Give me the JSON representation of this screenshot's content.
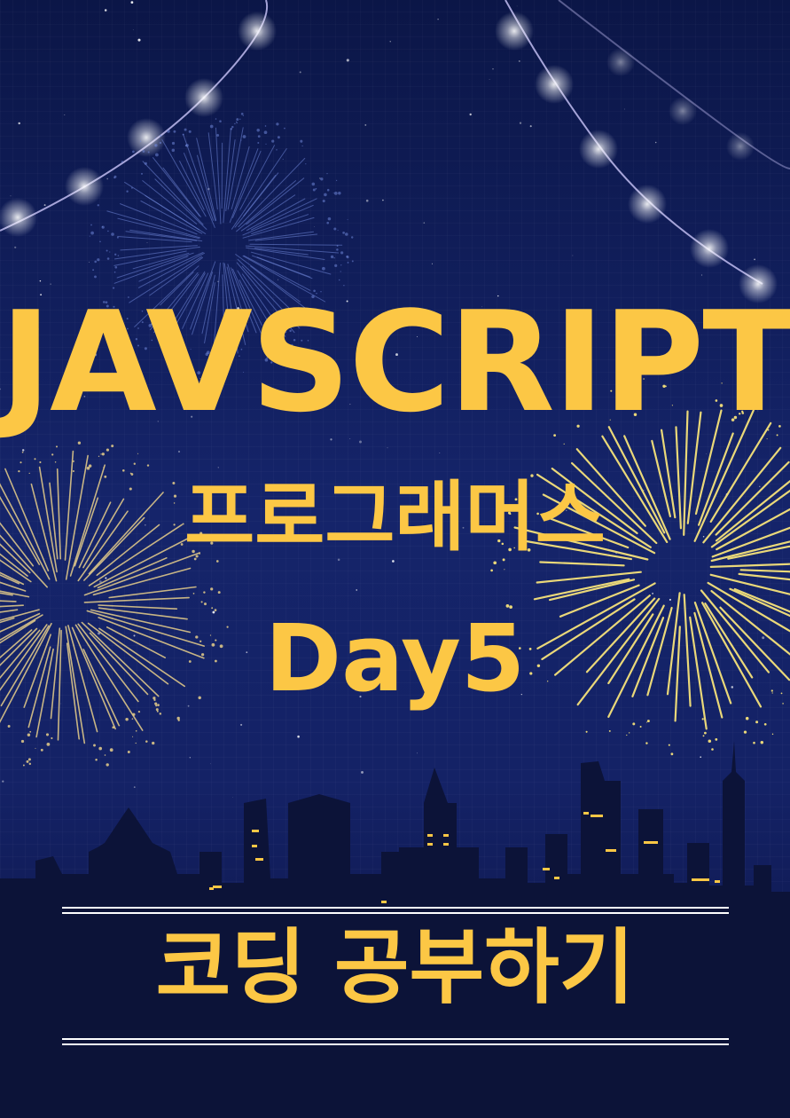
{
  "poster": {
    "title": "JAVSCRIPT",
    "subtitle": "프로그래머스",
    "day": "Day5",
    "banner": "코딩 공부하기"
  },
  "colors": {
    "accent": "#fcc745",
    "background": "#142266",
    "skyline": "#0c1338",
    "light": "#ffffff"
  }
}
